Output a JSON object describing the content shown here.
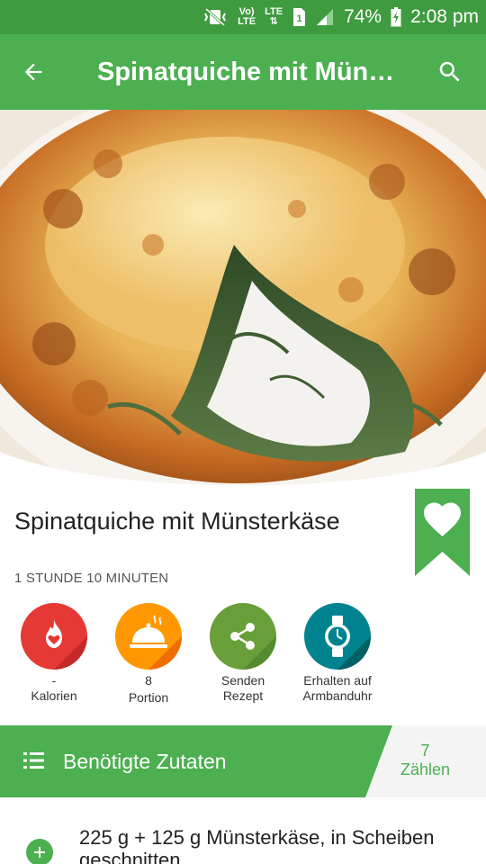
{
  "status_bar": {
    "volte": "Vo)\nLTE",
    "lte": "LTE",
    "sim": "1",
    "battery": "74%",
    "time": "2:08 pm"
  },
  "app_bar": {
    "title": "Spinatquiche mit Müns…"
  },
  "recipe": {
    "title": "Spinatquiche mit Münsterkäse",
    "duration": "1 STUNDE 10 MINUTEN"
  },
  "actions": [
    {
      "value": "-",
      "label": "Kalorien",
      "color": "#e53935",
      "icon": "flame-heart-icon"
    },
    {
      "value": "8",
      "label": "Portion",
      "color": "#ff9800",
      "icon": "cloche-icon"
    },
    {
      "value": "Senden",
      "label": "Rezept",
      "color": "#689f38",
      "icon": "share-icon"
    },
    {
      "value": "Erhalten auf",
      "label": "Armbanduhr",
      "color": "#00838f",
      "icon": "watch-icon"
    }
  ],
  "ingredients": {
    "header": "Benötigte Zutaten",
    "count_value": "7",
    "count_label": "Zählen",
    "items": [
      {
        "text": "225 g + 125 g Münsterkäse, in Scheiben geschnitten"
      }
    ]
  },
  "colors": {
    "primary": "#4caf50",
    "primary_dark": "#3f9b3f"
  }
}
